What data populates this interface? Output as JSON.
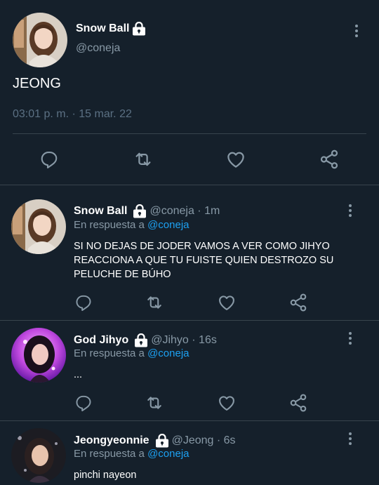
{
  "main_tweet": {
    "name": "Snow Ball",
    "handle": "@coneja",
    "text": "JEONG",
    "timestamp": "03:01 p. m. · 15 mar. 22"
  },
  "replies": [
    {
      "name": "Snow Ball",
      "meta": "@coneja · 1m",
      "reply_prefix": "En respuesta a",
      "reply_to": "@coneja",
      "text": "SI NO DEJAS DE JODER VAMOS A VER COMO JIHYO REACCIONA A QUE TU FUISTE QUIEN DESTROZO SU PELUCHE DE BÚHO"
    },
    {
      "name": "God Jihyo",
      "meta": "@Jihyo · 16s",
      "reply_prefix": "En respuesta a",
      "reply_to": "@coneja",
      "text": "..."
    },
    {
      "name": "Jeongyeonnie",
      "meta": "@Jeong · 6s",
      "reply_prefix": "En respuesta a",
      "reply_to": "@coneja",
      "text": "pinchi nayeon"
    }
  ],
  "icons": {
    "lock": "lock-icon",
    "more": "more-vertical-icon",
    "reply": "reply-icon",
    "retweet": "retweet-icon",
    "like": "heart-icon",
    "share": "share-icon"
  },
  "colors": {
    "background": "#15202b",
    "divider": "#38444d",
    "secondary_text": "#8899a6",
    "link": "#1da1f2"
  }
}
